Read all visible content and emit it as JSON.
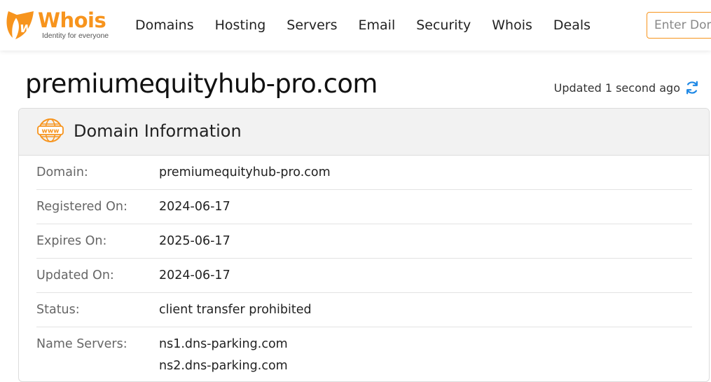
{
  "brand": {
    "name": "Whois",
    "tagline": "Identity for everyone",
    "accent_color": "#f7941d"
  },
  "nav": {
    "items": [
      {
        "label": "Domains"
      },
      {
        "label": "Hosting"
      },
      {
        "label": "Servers"
      },
      {
        "label": "Email"
      },
      {
        "label": "Security"
      },
      {
        "label": "Whois"
      },
      {
        "label": "Deals"
      }
    ]
  },
  "search": {
    "placeholder": "Enter Domain"
  },
  "page": {
    "title": "premiumequityhub-pro.com",
    "updated_text": "Updated 1 second ago",
    "refresh_icon": "refresh-icon",
    "refresh_color": "#1e88e5"
  },
  "domain_info": {
    "title": "Domain Information",
    "icon": "www-icon",
    "rows": [
      {
        "label": "Domain:",
        "value": "premiumequityhub-pro.com"
      },
      {
        "label": "Registered On:",
        "value": "2024-06-17"
      },
      {
        "label": "Expires On:",
        "value": "2025-06-17"
      },
      {
        "label": "Updated On:",
        "value": "2024-06-17"
      },
      {
        "label": "Status:",
        "value": "client transfer prohibited"
      }
    ],
    "name_servers": {
      "label": "Name Servers:",
      "values": [
        "ns1.dns-parking.com",
        "ns2.dns-parking.com"
      ]
    }
  }
}
